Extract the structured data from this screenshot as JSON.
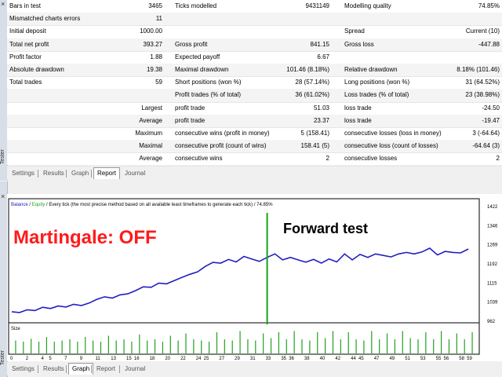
{
  "report": {
    "rows": [
      {
        "c1": "Bars in test",
        "v1": "3465",
        "c2": "Ticks modelled",
        "v2": "9431149",
        "c3": "Modelling quality",
        "v3": "74.85%"
      },
      {
        "c1": "Mismatched charts errors",
        "v1": "11",
        "c2": "",
        "v2": "",
        "c3": "",
        "v3": ""
      },
      {
        "c1": "Initial deposit",
        "v1": "1000.00",
        "c2": "",
        "v2": "",
        "c3": "Spread",
        "v3": "Current (10)"
      },
      {
        "c1": "Total net profit",
        "v1": "393.27",
        "c2": "Gross profit",
        "v2": "841.15",
        "c3": "Gross loss",
        "v3": "-447.88"
      },
      {
        "c1": "Profit factor",
        "v1": "1.88",
        "c2": "Expected payoff",
        "v2": "6.67",
        "c3": "",
        "v3": ""
      },
      {
        "c1": "Absolute drawdown",
        "v1": "19.38",
        "c2": "Maximal drawdown",
        "v2": "101.46 (8.18%)",
        "c3": "Relative drawdown",
        "v3": "8.18% (101.46)"
      },
      {
        "c1": "Total trades",
        "v1": "59",
        "c2": "Short positions (won %)",
        "v2": "28 (57.14%)",
        "c3": "Long positions (won %)",
        "v3": "31 (64.52%)"
      },
      {
        "c1": "",
        "v1": "",
        "c2": "Profit trades (% of total)",
        "v2": "36 (61.02%)",
        "c3": "Loss trades (% of total)",
        "v3": "23 (38.98%)"
      },
      {
        "c1": "Largest",
        "v1": "",
        "c2": "profit trade",
        "v2": "51.03",
        "c3": "loss trade",
        "v3": "-24.50"
      },
      {
        "c1": "Average",
        "v1": "",
        "c2": "profit trade",
        "v2": "23.37",
        "c3": "loss trade",
        "v3": "-19.47"
      },
      {
        "c1": "Maximum",
        "v1": "",
        "c2": "consecutive wins (profit in money)",
        "v2": "5 (158.41)",
        "c3": "consecutive losses (loss in money)",
        "v3": "3 (-64.64)"
      },
      {
        "c1": "Maximal",
        "v1": "",
        "c2": "consecutive profit (count of wins)",
        "v2": "158.41 (5)",
        "c3": "consecutive loss (count of losses)",
        "v3": "-64.64 (3)"
      },
      {
        "c1": "Average",
        "v1": "",
        "c2": "consecutive wins",
        "v2": "2",
        "c3": "consecutive losses",
        "v3": "2"
      }
    ],
    "quality_fill_pct": 74.85,
    "quality_colors": {
      "gray": "#a8a8a8",
      "green1": "#19c519",
      "green2": "#0aa00a"
    }
  },
  "tabs_top": [
    "Settings",
    "Results",
    "Graph",
    "Report",
    "Journal"
  ],
  "tabs_top_active": "Report",
  "tabs_bottom": [
    "Settings",
    "Results",
    "Graph",
    "Report",
    "Journal"
  ],
  "tabs_bottom_active": "Graph",
  "side_label": "Tester",
  "chart": {
    "header_balance": "Balance",
    "header_sep1": " / ",
    "header_equity": "Equity",
    "header_rest": " / Every tick (the most precise method based on all available least timeframes to generate each tick) / 74.85%",
    "overlay_title": "Martingale: OFF",
    "overlay_forward": "Forward test",
    "size_label": "Size",
    "colors": {
      "line": "#2020c0",
      "vol": "#22a022",
      "forward": "#18a018",
      "title": "#ff1a1a",
      "equity": "#22a022"
    }
  },
  "chart_data": {
    "type": "line",
    "title": "",
    "yticks": [
      "1422",
      "1346",
      "1269",
      "1192",
      "1115",
      "1039",
      "962"
    ],
    "ylim": [
      962,
      1422
    ],
    "xticks": [
      "0",
      "2",
      "4",
      "5",
      "7",
      "9",
      "11",
      "13",
      "15",
      "16",
      "18",
      "20",
      "22",
      "24",
      "25",
      "27",
      "29",
      "31",
      "33",
      "35",
      "36",
      "38",
      "40",
      "42",
      "44",
      "45",
      "47",
      "49",
      "51",
      "53",
      "55",
      "56",
      "58",
      "59"
    ],
    "xlim": [
      0,
      60
    ],
    "forward_test_x": 33,
    "series": [
      {
        "name": "Balance",
        "x": [
          0,
          1,
          2,
          3,
          4,
          5,
          6,
          7,
          8,
          9,
          10,
          11,
          12,
          13,
          14,
          15,
          16,
          17,
          18,
          19,
          20,
          21,
          22,
          23,
          24,
          25,
          26,
          27,
          28,
          29,
          30,
          31,
          32,
          33,
          34,
          35,
          36,
          37,
          38,
          39,
          40,
          41,
          42,
          43,
          44,
          45,
          46,
          47,
          48,
          49,
          50,
          51,
          52,
          53,
          54,
          55,
          56,
          57,
          58,
          59
        ],
        "y": [
          1000,
          997,
          1008,
          1005,
          1018,
          1013,
          1023,
          1019,
          1030,
          1025,
          1035,
          1050,
          1060,
          1055,
          1068,
          1072,
          1085,
          1100,
          1098,
          1115,
          1112,
          1125,
          1138,
          1150,
          1160,
          1182,
          1198,
          1195,
          1210,
          1200,
          1222,
          1212,
          1202,
          1218,
          1232,
          1208,
          1218,
          1208,
          1199,
          1210,
          1195,
          1212,
          1200,
          1232,
          1208,
          1230,
          1218,
          1232,
          1226,
          1220,
          1232,
          1238,
          1232,
          1240,
          1255,
          1228,
          1242,
          1238,
          1236,
          1252
        ]
      }
    ],
    "volumes": [
      0.55,
      0.5,
      0.62,
      0.5,
      0.7,
      0.5,
      0.55,
      0.6,
      0.5,
      0.7,
      0.55,
      0.5,
      0.75,
      0.55,
      0.6,
      0.5,
      0.8,
      0.55,
      0.6,
      0.5,
      0.75,
      0.55,
      0.85,
      0.6,
      0.55,
      0.5,
      0.9,
      0.6,
      0.55,
      0.95,
      0.6,
      0.55,
      0.85,
      0.65,
      0.9,
      0.6,
      0.95,
      0.6,
      0.55,
      0.9,
      0.65,
      0.95,
      0.6,
      0.9,
      0.6,
      0.55,
      0.95,
      0.6,
      0.85,
      0.6,
      0.95,
      0.65,
      0.6,
      0.9,
      0.6,
      0.95,
      0.6,
      0.85,
      0.6,
      0.9
    ]
  }
}
